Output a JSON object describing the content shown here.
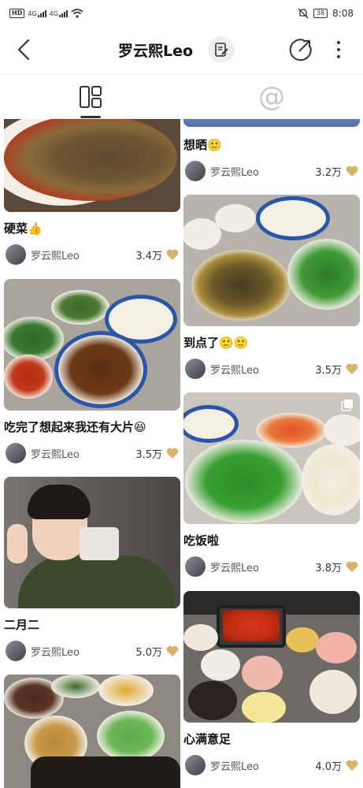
{
  "status_bar": {
    "hd": "HD",
    "sig1": "4G",
    "sig2": "4G",
    "battery": "38",
    "time": "8:08"
  },
  "header": {
    "title": "罗云熙Leo"
  },
  "tabs": [
    {
      "icon": "grid-icon",
      "active": true
    },
    {
      "icon": "at-icon",
      "label": "@",
      "active": false
    }
  ],
  "colors": {
    "heart": "#d9b36a",
    "bowl_blue": "#2a55a8"
  },
  "posts": [
    {
      "title": "硬菜👍",
      "author": "罗云熙Leo",
      "likes": "3.4万"
    },
    {
      "title": "想晒🙂",
      "author": "罗云熙Leo",
      "likes": "3.2万"
    },
    {
      "title": "到点了🙂🙂",
      "author": "罗云熙Leo",
      "likes": "3.5万"
    },
    {
      "title": "吃完了想起来我还有大片😆",
      "author": "罗云熙Leo",
      "likes": "3.5万"
    },
    {
      "title": "吃饭啦",
      "author": "罗云熙Leo",
      "likes": "3.8万"
    },
    {
      "title": "二月二",
      "author": "罗云熙Leo",
      "likes": "5.0万"
    },
    {
      "title": "心满意足",
      "author": "罗云熙Leo",
      "likes": "4.0万"
    }
  ]
}
